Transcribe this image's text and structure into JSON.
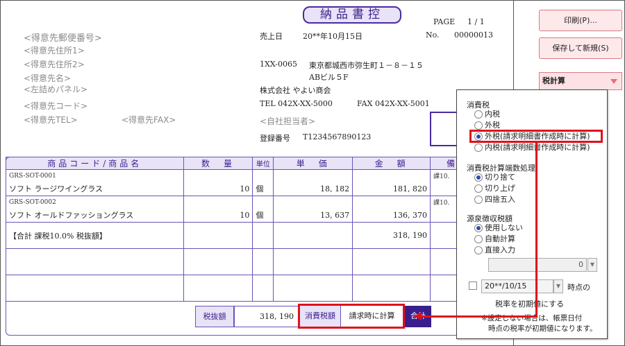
{
  "doc": {
    "title": "納品書控",
    "page_label": "PAGE",
    "page_value": "1 / 1",
    "sale_date_label": "売上日",
    "sale_date": "20**年10月15日",
    "no_label": "No.",
    "no_value": "00000013"
  },
  "customer": {
    "zip": "<得意先郵便番号>",
    "addr1": "<得意先住所1>",
    "addr2": "<得意先住所2>",
    "name": "<得意先名>",
    "panel": "<左詰めパネル>",
    "code": "<得意先コード>",
    "tel": "<得意先TEL>",
    "fax": "<得意先FAX>"
  },
  "company": {
    "zip": "1XX-0065",
    "address": "東京都城西市弥生町１－８－１５",
    "building": "ABビル５F",
    "name": "株式会社 やよい商会",
    "tel": "TEL 042X-XX-5000",
    "fax": "FAX 042X-XX-5001",
    "staff": "<自社担当者>",
    "reg_label": "登録番号",
    "reg_no": "T1234567890123"
  },
  "table": {
    "headers": [
      "商品コード/商品名",
      "数　量",
      "単位",
      "単　価",
      "金　額",
      "備"
    ],
    "items": [
      {
        "code": "GRS-SOT-0001",
        "name": "ソフト ラージワイングラス",
        "qty": "10",
        "unit": "個",
        "price": "18, 182",
        "amount": "181, 820",
        "note": "課10."
      },
      {
        "code": "GRS-SOT-0002",
        "name": "ソフト オールドファッショングラス",
        "qty": "10",
        "unit": "個",
        "price": "13, 637",
        "amount": "136, 370",
        "note": "課10."
      }
    ],
    "sum_label": "【合計 課税10.0% 税抜額】",
    "sum_value": "318, 190"
  },
  "totals": {
    "subtotal_label": "税抜額",
    "subtotal_value": "318, 190",
    "tax_label": "消費税額",
    "tax_value": "請求時に計算",
    "total_label": "合計"
  },
  "right_panel": {
    "print_button": "印刷(P)...",
    "save_new_button": "保存して新規(S)",
    "tax_calc_dropdown": "税計算"
  },
  "popup": {
    "sec_tax": "消費税",
    "tax_options": [
      "内税",
      "外税",
      "外税(請求明細書作成時に計算)",
      "内税(請求明細書作成時に計算)"
    ],
    "tax_selected": 2,
    "sec_rounding": "消費税計算端数処理",
    "rounding_options": [
      "切り捨て",
      "切り上げ",
      "四捨五入"
    ],
    "rounding_selected": 0,
    "sec_withholding": "源泉徴収税額",
    "withholding_options": [
      "使用しない",
      "自動計算",
      "直接入力"
    ],
    "withholding_selected": 0,
    "direct_value": "0",
    "date_value": "20**/10/15",
    "date_suffix": "時点の",
    "rate_note": "税率を初期値にする",
    "footnote_1": "※設定しない場合は、帳票日付",
    "footnote_2": "時点の税率が初期値になります。"
  },
  "colors": {
    "accent_purple": "#3a1f8c",
    "header_fill": "#e9e3f7",
    "highlight_red": "#e0101a",
    "button_pink": "#fde8ea"
  }
}
